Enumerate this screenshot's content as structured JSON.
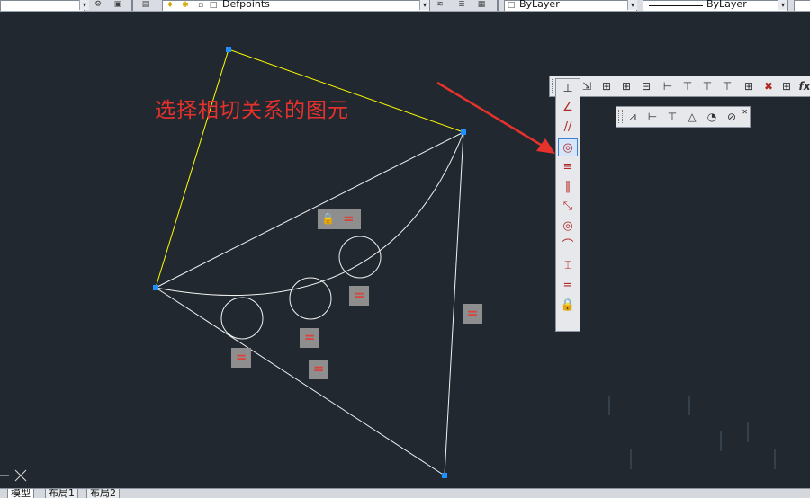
{
  "toolbar": {
    "left_combo_text": "",
    "layer_value": "Defpoints",
    "color_value": "ByLayer",
    "linetype_value": "ByLayer"
  },
  "annotation": {
    "text": "选择相切关系的图元"
  },
  "geometric_constraints": {
    "vertical_items": [
      "coincident",
      "perpendicular",
      "parallel",
      "tangent",
      "horizontal",
      "vertical",
      "collinear",
      "concentric",
      "smooth",
      "symmetric",
      "equal",
      "fix"
    ],
    "selected_item": "tangent"
  },
  "dimensional_constraints": {
    "fx_label": "fx"
  },
  "constraint_badges": {
    "equal_symbol": "="
  },
  "tabs": [
    "模型",
    "布局1",
    "布局2"
  ],
  "colors": {
    "background": "#212830",
    "geometry": "#ffffff",
    "selected": "#ffff00",
    "grip": "#1e90ff",
    "annotation": "#e5322d"
  }
}
